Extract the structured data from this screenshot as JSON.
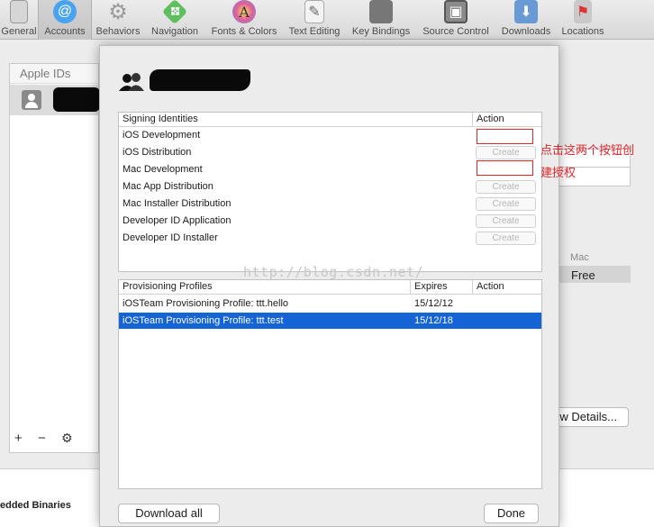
{
  "toolbar": {
    "items": [
      {
        "label": "General",
        "icon": "general-icon"
      },
      {
        "label": "Accounts",
        "icon": "at-sign-icon"
      },
      {
        "label": "Behaviors",
        "icon": "gear-icon"
      },
      {
        "label": "Navigation",
        "icon": "navigation-arrows-icon"
      },
      {
        "label": "Fonts & Colors",
        "icon": "fonts-icon"
      },
      {
        "label": "Text Editing",
        "icon": "text-editing-icon"
      },
      {
        "label": "Key Bindings",
        "icon": "key-bindings-icon"
      },
      {
        "label": "Source Control",
        "icon": "source-control-icon"
      },
      {
        "label": "Downloads",
        "icon": "downloads-icon"
      },
      {
        "label": "Locations",
        "icon": "locations-icon"
      }
    ],
    "active": "Accounts"
  },
  "accounts": {
    "apple_ids_header": "Apple IDs",
    "add": "+",
    "remove": "−",
    "settings_icon": "gear-icon"
  },
  "background_right": {
    "mac_header": "Mac",
    "free_label": "Free",
    "details_button": "w Details..."
  },
  "background_bottom": {
    "embedded_label": "edded Binaries"
  },
  "sheet": {
    "signing": {
      "header_name": "Signing Identities",
      "header_action": "Action",
      "rows": [
        {
          "name": "iOS Development",
          "action": "",
          "highlighted": true
        },
        {
          "name": "iOS Distribution",
          "action": "Create",
          "highlighted": false
        },
        {
          "name": "Mac Development",
          "action": "",
          "highlighted": true
        },
        {
          "name": "Mac App Distribution",
          "action": "Create",
          "highlighted": false
        },
        {
          "name": "Mac Installer Distribution",
          "action": "Create",
          "highlighted": false
        },
        {
          "name": "Developer ID Application",
          "action": "Create",
          "highlighted": false
        },
        {
          "name": "Developer ID Installer",
          "action": "Create",
          "highlighted": false
        }
      ]
    },
    "profiles": {
      "header_name": "Provisioning Profiles",
      "header_expires": "Expires",
      "header_action": "Action",
      "rows": [
        {
          "name": "iOSTeam Provisioning Profile: ttt.hello",
          "expires": "15/12/12",
          "selected": false
        },
        {
          "name": "iOSTeam Provisioning Profile: ttt.test",
          "expires": "15/12/18",
          "selected": true
        }
      ]
    },
    "download_all": "Download all",
    "done": "Done"
  },
  "annotation": {
    "line1": "点击这两个按钮创",
    "line2": "建授权"
  },
  "watermark": "http://blog.csdn.net/",
  "colors": {
    "selection": "#1464d6",
    "annotation_red": "#e0262b"
  }
}
